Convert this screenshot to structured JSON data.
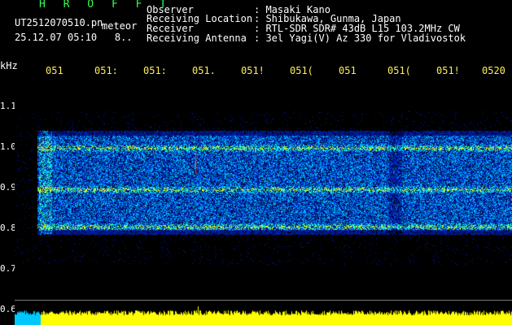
{
  "header": {
    "app_title": "H R O F F T",
    "file_name": "UT2512070510.pn",
    "meteor_label": "meteor",
    "datetime": "25.12.07 05:10",
    "counter": "8..",
    "labels": [
      "Observer",
      "Receiving Location",
      "Receiver",
      "Receiving Antenna"
    ],
    "values": [
      ": Masaki Kano",
      ": Shibukawa, Gunma, Japan",
      ": RTL-SDR SDR# 43dB L15 103.2MHz CW",
      ": 3el Yagi(V) Az 330 for Vladivostok"
    ]
  },
  "axis": {
    "unit": "kHz",
    "y_ticks": [
      "1.1",
      "1.0",
      "0.9",
      "0.8",
      "0.7",
      "0.6"
    ],
    "x_ticks": [
      "051",
      "051:",
      "051:",
      "051.",
      "051!",
      "051(",
      "051",
      "051(",
      "051!",
      "0520"
    ]
  },
  "colors": {
    "background": "#000000",
    "title": "#33ff55",
    "x_ticks": "#ffee55",
    "histogram": "#ffff00",
    "histogram_low": "#00c8ff"
  }
}
